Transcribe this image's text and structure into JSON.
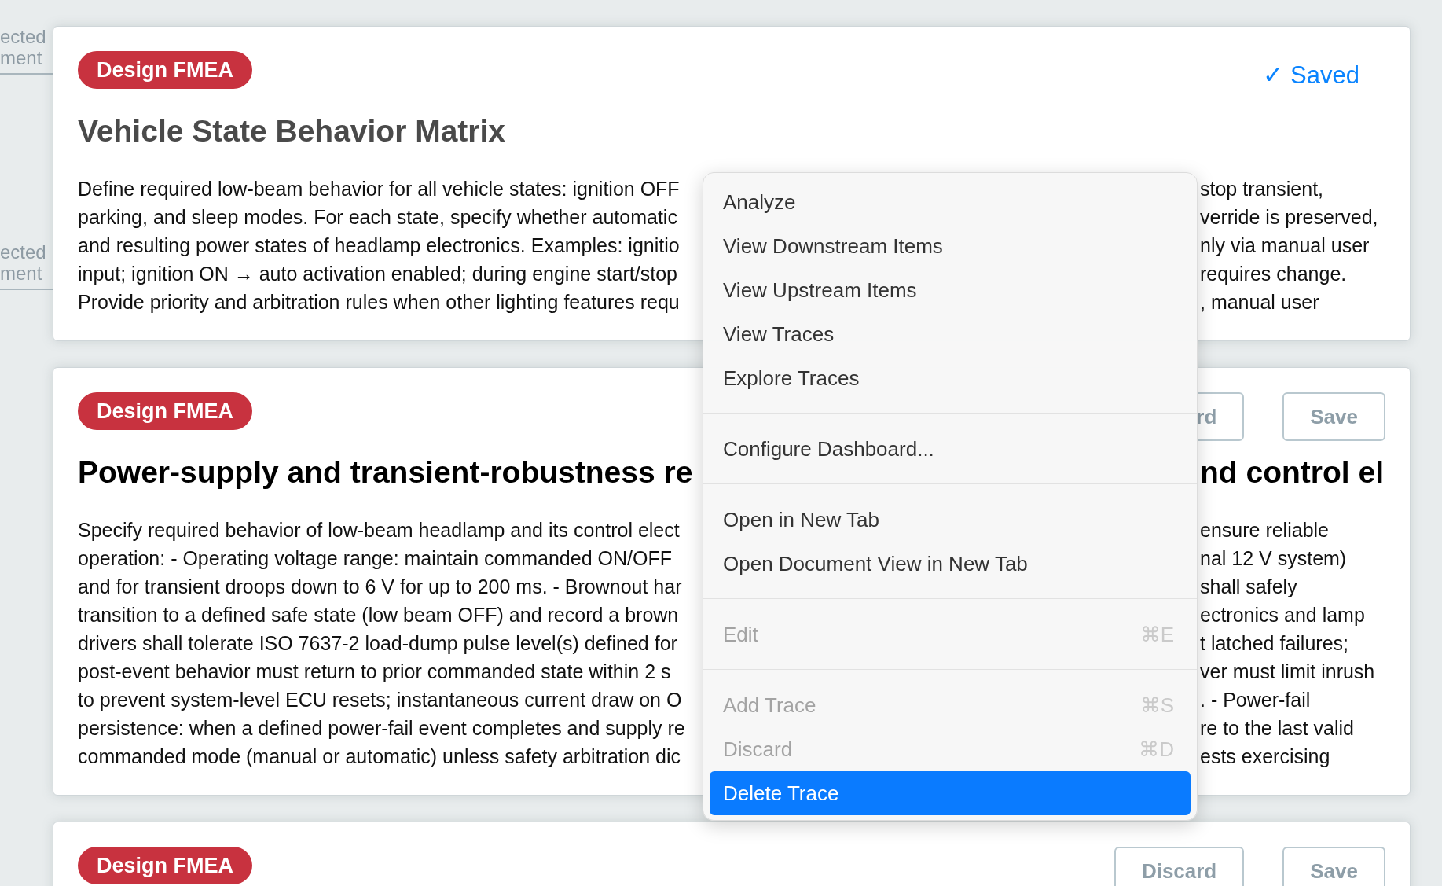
{
  "stubs": [
    "ected\nment",
    "ected\nment"
  ],
  "cards": [
    {
      "badge": "Design FMEA",
      "status": "✓ Saved",
      "title": "Vehicle State Behavior Matrix",
      "lines": [
        {
          "left": "Define required low-beam behavior for all vehicle states: ignition OFF",
          "right": "stop transient,"
        },
        {
          "left": "parking, and sleep modes. For each state, specify whether automatic",
          "right": "verride is preserved,"
        },
        {
          "left": "and resulting power states of headlamp electronics. Examples: ignitio",
          "right": "nly via manual user"
        },
        {
          "left": "input; ignition ON → auto activation enabled; during engine start/stop",
          "right": "requires change."
        },
        {
          "left": "Provide priority and arbitration rules when other lighting features requ",
          "right": ", manual user"
        }
      ]
    },
    {
      "badge": "Design FMEA",
      "title": "Power-supply and transient-robustness re",
      "title_right": "nd control el",
      "buttons": [
        {
          "label": "rd",
          "kind": "partial"
        },
        {
          "label": "Save",
          "kind": "full"
        }
      ],
      "lines": [
        {
          "left": "Specify required behavior of low-beam headlamp and its control elect",
          "right": "ensure reliable"
        },
        {
          "left": "operation: - Operating voltage range: maintain commanded ON/OFF",
          "right": "nal 12 V system)"
        },
        {
          "left": "and for transient droops down to 6 V for up to 200 ms. - Brownout har",
          "right": "shall safely"
        },
        {
          "left": "transition to a defined safe state (low beam OFF) and record a brown",
          "right": "ectronics and lamp"
        },
        {
          "left": "drivers shall tolerate ISO 7637-2 load-dump pulse level(s) defined for",
          "right": "t latched failures;"
        },
        {
          "left": "post-event behavior must return to prior commanded state within 2 s",
          "right": "ver must limit inrush"
        },
        {
          "left": "to prevent system-level ECU resets; instantaneous current draw on O",
          "right": ". - Power-fail"
        },
        {
          "left": "persistence: when a defined power-fail event completes and supply re",
          "right": "re to the last valid"
        },
        {
          "left": "commanded mode (manual or automatic) unless safety arbitration dic",
          "right": "ests exercising"
        }
      ]
    },
    {
      "badge": "Design FMEA",
      "buttons": [
        {
          "label": "Discard",
          "kind": "full"
        },
        {
          "label": "Save",
          "kind": "full"
        }
      ]
    }
  ],
  "menu": {
    "groups": [
      {
        "items": [
          {
            "label": "Analyze",
            "disabled": false,
            "selected": false
          },
          {
            "label": "View Downstream Items",
            "disabled": false,
            "selected": false
          },
          {
            "label": "View Upstream Items",
            "disabled": false,
            "selected": false
          },
          {
            "label": "View Traces",
            "disabled": false,
            "selected": false
          },
          {
            "label": "Explore Traces",
            "disabled": false,
            "selected": false
          }
        ]
      },
      {
        "items": [
          {
            "label": "Configure Dashboard...",
            "disabled": false,
            "selected": false
          }
        ]
      },
      {
        "items": [
          {
            "label": "Open in New Tab",
            "disabled": false,
            "selected": false
          },
          {
            "label": "Open Document View in New Tab",
            "disabled": false,
            "selected": false
          }
        ]
      },
      {
        "items": [
          {
            "label": "Edit",
            "shortcut": "⌘E",
            "disabled": true,
            "selected": false
          }
        ]
      },
      {
        "items": [
          {
            "label": "Add Trace",
            "shortcut": "⌘S",
            "disabled": true,
            "selected": false
          },
          {
            "label": "Discard",
            "shortcut": "⌘D",
            "disabled": true,
            "selected": false
          },
          {
            "label": "Delete Trace",
            "disabled": false,
            "selected": true
          }
        ]
      }
    ]
  }
}
